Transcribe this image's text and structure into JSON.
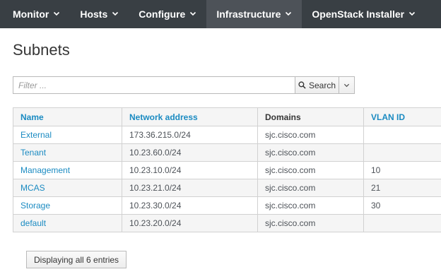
{
  "nav": {
    "items": [
      {
        "label": "Monitor",
        "active": false
      },
      {
        "label": "Hosts",
        "active": false
      },
      {
        "label": "Configure",
        "active": false
      },
      {
        "label": "Infrastructure",
        "active": true
      },
      {
        "label": "OpenStack Installer",
        "active": false
      }
    ],
    "icon": "chevron-down-icon",
    "colors": {
      "bar": "#393f44",
      "active": "#4d5258",
      "text": "#ffffff"
    }
  },
  "page": {
    "title": "Subnets"
  },
  "filter": {
    "placeholder": "Filter ...",
    "value": "",
    "search_label": "Search",
    "search_icon": "search-icon",
    "dropdown_icon": "caret-down-icon"
  },
  "table": {
    "columns": [
      "Name",
      "Network address",
      "Domains",
      "VLAN ID"
    ],
    "rows": [
      {
        "name": "External",
        "network": "173.36.215.0/24",
        "domain": "sjc.cisco.com",
        "vlan": ""
      },
      {
        "name": "Tenant",
        "network": "10.23.60.0/24",
        "domain": "sjc.cisco.com",
        "vlan": ""
      },
      {
        "name": "Management",
        "network": "10.23.10.0/24",
        "domain": "sjc.cisco.com",
        "vlan": "10"
      },
      {
        "name": "MCAS",
        "network": "10.23.21.0/24",
        "domain": "sjc.cisco.com",
        "vlan": "21"
      },
      {
        "name": "Storage",
        "network": "10.23.30.0/24",
        "domain": "sjc.cisco.com",
        "vlan": "30"
      },
      {
        "name": "default",
        "network": "10.23.20.0/24",
        "domain": "sjc.cisco.com",
        "vlan": ""
      }
    ],
    "link_color": "#1b8bc2"
  },
  "footer": {
    "count_label": "Displaying all 6 entries"
  }
}
